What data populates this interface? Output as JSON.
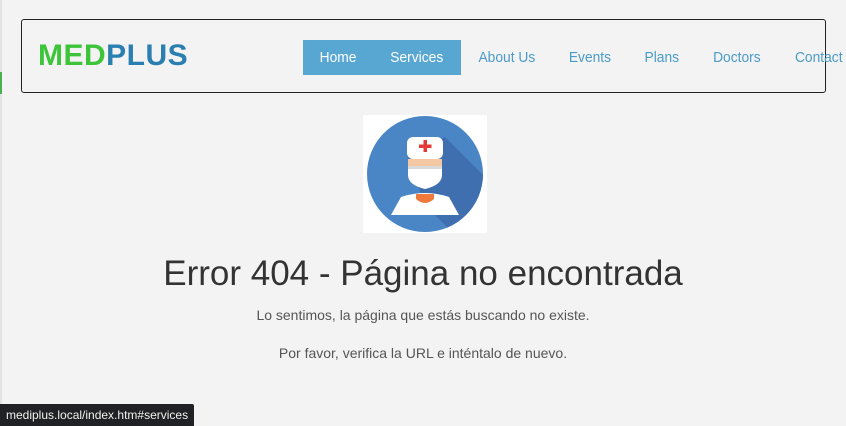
{
  "brand": {
    "part1": "MED",
    "part2": "PLUS",
    "color1": "#3ec43a",
    "color2": "#2a7fb0"
  },
  "nav": {
    "items": [
      {
        "label": "Home",
        "active": true
      },
      {
        "label": "Services",
        "active": true
      },
      {
        "label": "About Us",
        "active": false
      },
      {
        "label": "Events",
        "active": false
      },
      {
        "label": "Plans",
        "active": false
      },
      {
        "label": "Doctors",
        "active": false
      },
      {
        "label": "Contact Us",
        "active": false
      }
    ],
    "active_color": "#58a6d2",
    "link_color": "#4a9bc8"
  },
  "error": {
    "icon": "doctor-avatar-icon",
    "title": "Error 404 - Página no encontrada",
    "message1": "Lo sentimos, la página que estás buscando no existe.",
    "message2": "Por favor, verifica la URL e inténtalo de nuevo."
  },
  "status_bar": {
    "url": "mediplus.local/index.htm#services"
  }
}
